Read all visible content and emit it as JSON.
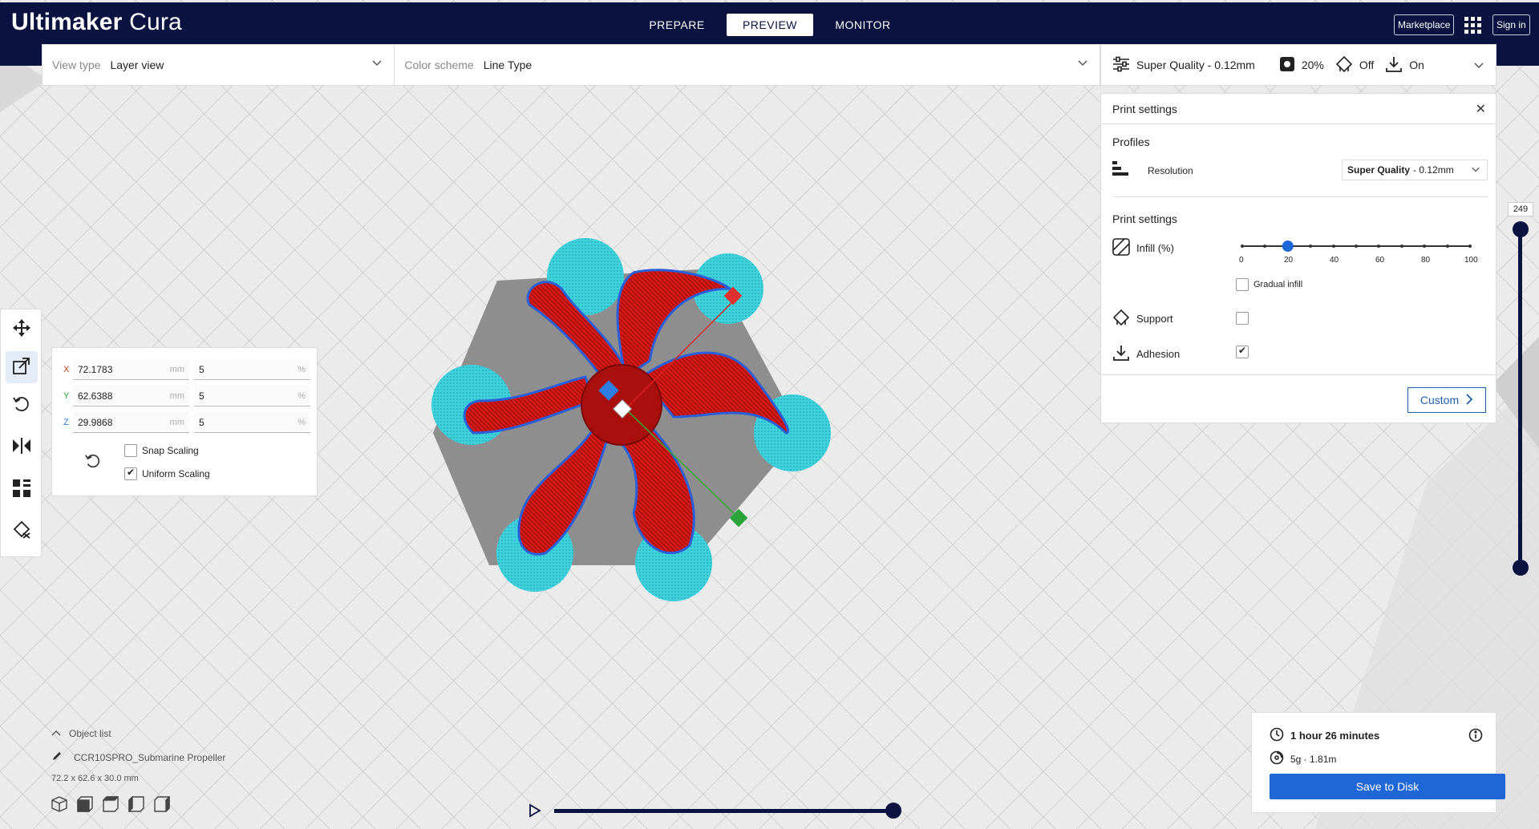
{
  "app": {
    "brand_bold": "Ultimaker",
    "brand_light": "Cura"
  },
  "stages": [
    {
      "label": "PREPARE",
      "active": false
    },
    {
      "label": "PREVIEW",
      "active": true
    },
    {
      "label": "MONITOR",
      "active": false
    }
  ],
  "header": {
    "marketplace_label": "Marketplace",
    "signin_label": "Sign in"
  },
  "viewbar": {
    "view_type_label": "View type",
    "view_type_value": "Layer view",
    "color_scheme_label": "Color scheme",
    "color_scheme_value": "Line Type"
  },
  "settings_bar": {
    "profile": "Super Quality - 0.12mm",
    "infill": "20%",
    "support": "Off",
    "adhesion": "On"
  },
  "print_settings": {
    "title": "Print settings",
    "profiles_title": "Profiles",
    "resolution_label": "Resolution",
    "resolution_bold": "Super Quality",
    "resolution_rest": "- 0.12mm",
    "section_title": "Print settings",
    "infill_label": "Infill (%)",
    "infill_value": 20,
    "infill_ticks": [
      "0",
      "20",
      "40",
      "60",
      "80",
      "100"
    ],
    "gradual_infill_label": "Gradual infill",
    "gradual_infill": false,
    "support_label": "Support",
    "support": false,
    "adhesion_label": "Adhesion",
    "adhesion": true,
    "custom_label": "Custom"
  },
  "scale_tool": {
    "rows": [
      {
        "axis": "X",
        "mm": "72.1783",
        "mm_unit": "mm",
        "pct": "5",
        "pct_unit": "%"
      },
      {
        "axis": "Y",
        "mm": "62.6388",
        "mm_unit": "mm",
        "pct": "5",
        "pct_unit": "%"
      },
      {
        "axis": "Z",
        "mm": "29.9868",
        "mm_unit": "mm",
        "pct": "5",
        "pct_unit": "%"
      }
    ],
    "snap_scaling_label": "Snap Scaling",
    "snap_scaling": false,
    "uniform_scaling_label": "Uniform Scaling",
    "uniform_scaling": true
  },
  "layer_slider": {
    "layer": "249"
  },
  "object_list": {
    "title": "Object list",
    "object_name": "CCR10SPRO_Submarine Propeller",
    "dimensions": "72.2 x 62.6 x 30.0 mm"
  },
  "estimate": {
    "time": "1 hour 26 minutes",
    "material": "5g · 1.81m",
    "save_label": "Save to Disk"
  },
  "colors": {
    "header": "#0a1240",
    "accent": "#1f66d6",
    "model_red": "#c8120f",
    "brim_cyan": "#35c9d3",
    "wall_blue": "#2b5fd9",
    "plate_gray": "#8e8e8e"
  }
}
